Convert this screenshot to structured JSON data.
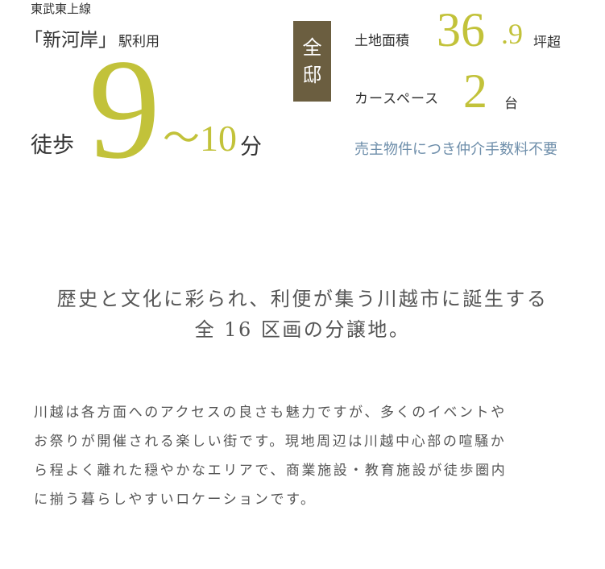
{
  "access": {
    "line_name": "東武東上線",
    "station": "「新河岸」",
    "station_suffix": "駅利用",
    "walk_label": "徒歩",
    "walk_min": "9",
    "walk_range": "〜10",
    "walk_unit": "分"
  },
  "badge": {
    "line1": "全",
    "line2": "邸"
  },
  "specs": {
    "land_label": "土地面積",
    "land_value": "36",
    "land_decimal": ".9",
    "land_unit": "坪超",
    "car_label": "カースペース",
    "car_value": "2",
    "car_unit": "台",
    "fee_note": "売主物件につき仲介手数料不要"
  },
  "headline": {
    "line1": "歴史と文化に彩られ、利便が集う川越市に誕生する",
    "line2": "全 16 区画の分譲地。"
  },
  "body": {
    "line1": "川越は各方面へのアクセスの良さも魅力ですが、多くのイベントや",
    "line2": "お祭りが開催される楽しい街です。現地周辺は川越中心部の喧騒か",
    "line3": "ら程よく離れた穏やかなエリアで、商業施設・教育施設が徒歩圏内",
    "line4": "に揃う暮らしやすいロケーションです。"
  },
  "colors": {
    "accent": "#c2c23a",
    "badge_bg": "#6b5e40",
    "note": "#6f8fab",
    "text": "#333333"
  }
}
